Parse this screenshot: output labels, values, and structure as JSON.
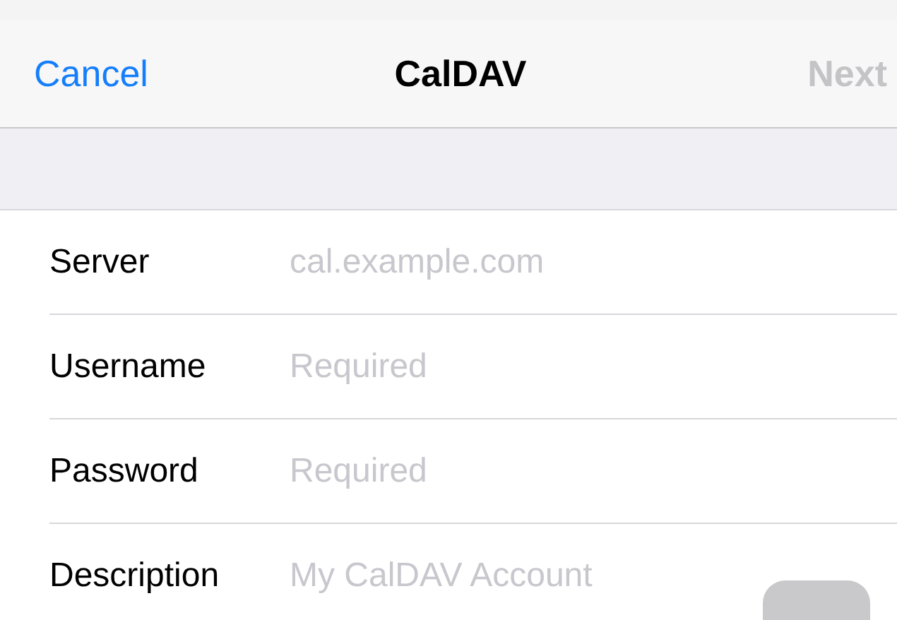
{
  "nav_bar": {
    "cancel": "Cancel",
    "title": "CalDAV",
    "next": {
      "label": "Next",
      "disabled": true
    }
  },
  "fields": [
    {
      "label": "Server",
      "placeholder": "cal.example.com"
    },
    {
      "label": "Username",
      "placeholder": "Required"
    },
    {
      "label": "Password",
      "placeholder": "Required"
    },
    {
      "label": "Description",
      "placeholder": "My CalDAV Account"
    }
  ]
}
